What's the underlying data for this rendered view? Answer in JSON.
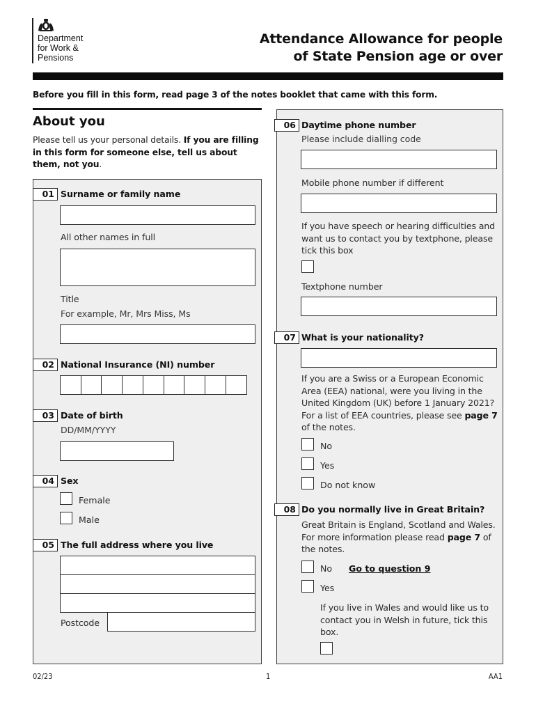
{
  "header": {
    "department": [
      "Department",
      "for Work &",
      "Pensions"
    ],
    "logo_icon": "royal-coat-of-arms-icon",
    "title_line1": "Attendance Allowance for people",
    "title_line2": "of State Pension age or over",
    "intro": "Before you fill in this form, read page 3 of the notes booklet that came with this form."
  },
  "about": {
    "title": "About you",
    "desc_plain": "Please tell us your personal details. ",
    "desc_bold": "If you are filling in this form for someone else, tell us about them, not you",
    "desc_end": "."
  },
  "questions": {
    "q01": {
      "num": "01",
      "label": "Surname or family name",
      "surname_value": "",
      "other_names_label": "All other names in full",
      "other_names_value": "",
      "title_label": "Title",
      "title_hint": "For example, Mr, Mrs Miss, Ms",
      "title_value": ""
    },
    "q02": {
      "num": "02",
      "label": "National Insurance (NI) number",
      "cells": [
        "",
        "",
        "",
        "",
        "",
        "",
        "",
        "",
        ""
      ]
    },
    "q03": {
      "num": "03",
      "label": "Date of birth",
      "hint": "DD/MM/YYYY",
      "value": ""
    },
    "q04": {
      "num": "04",
      "label": "Sex",
      "options": [
        {
          "label": "Female",
          "checked": false
        },
        {
          "label": "Male",
          "checked": false
        }
      ]
    },
    "q05": {
      "num": "05",
      "label": "The full address where you live",
      "address_lines": [
        "",
        "",
        ""
      ],
      "postcode_label": "Postcode",
      "postcode_value": ""
    },
    "q06": {
      "num": "06",
      "label": "Daytime phone number",
      "hint": "Please include dialling code",
      "daytime_value": "",
      "mobile_label": "Mobile phone number if different",
      "mobile_value": "",
      "textphone_text": "If you have speech or hearing difficulties and want us to contact you by textphone, please tick this box",
      "textphone_checked": false,
      "textphone_number_label": "Textphone number",
      "textphone_number_value": ""
    },
    "q07": {
      "num": "07",
      "label": "What is your nationality?",
      "value": "",
      "eea_text": "If you are a Swiss or a European Economic Area (EEA) national, were you living in the United Kingdom (UK) before 1 January 2021? For a list of EEA countries, please see ",
      "eea_bold": "page 7",
      "eea_end": " of the notes.",
      "options": [
        {
          "label": "No",
          "checked": false
        },
        {
          "label": "Yes",
          "checked": false
        },
        {
          "label": "Do not know",
          "checked": false
        }
      ]
    },
    "q08": {
      "num": "08",
      "label": "Do you normally live in Great Britain?",
      "desc_text": "Great Britain is England, Scotland and Wales. For more information please read ",
      "desc_bold": "page 7",
      "desc_end": " of the notes.",
      "options": [
        {
          "label": "No",
          "checked": false
        },
        {
          "label": "Yes",
          "checked": false
        }
      ],
      "goto_link": "Go to question 9",
      "welsh_text": "If you live in Wales and would like us to contact you in Welsh in future, tick this box.",
      "welsh_checked": false
    }
  },
  "footer": {
    "date_code": "02/23",
    "page": "1",
    "form_code": "AA1"
  }
}
